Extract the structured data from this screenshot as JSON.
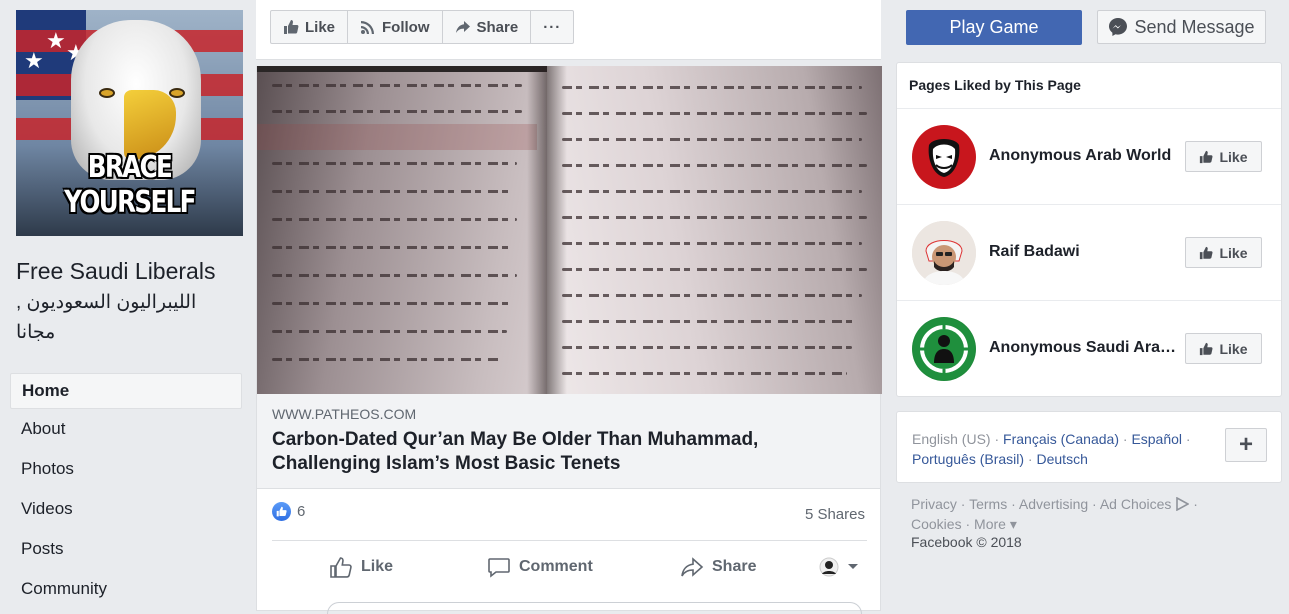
{
  "page": {
    "profile_image_text": "BRACE YOURSELF",
    "name": "Free Saudi Liberals",
    "name_ar": "الليبراليون السعوديون , مجانا"
  },
  "left_nav": {
    "items": [
      {
        "label": "Home",
        "active": true
      },
      {
        "label": "About"
      },
      {
        "label": "Photos"
      },
      {
        "label": "Videos"
      },
      {
        "label": "Posts"
      },
      {
        "label": "Community"
      }
    ]
  },
  "action_bar": {
    "like": "Like",
    "follow": "Follow",
    "share": "Share",
    "more": "···"
  },
  "cta": {
    "play_game": "Play Game",
    "send_message": "Send Message"
  },
  "post": {
    "domain": "WWW.PATHEOS.COM",
    "title": "Carbon-Dated Qur’an May Be Older Than Muhammad, Challenging Islam’s Most Basic Tenets",
    "like_count": "6",
    "shares": "5 Shares",
    "actions": {
      "like": "Like",
      "comment": "Comment",
      "share": "Share"
    }
  },
  "pages_liked": {
    "title": "Pages Liked by This Page",
    "items": [
      {
        "name": "Anonymous Arab World",
        "button": "Like"
      },
      {
        "name": "Raif Badawi",
        "button": "Like"
      },
      {
        "name": "Anonymous Saudi Arabia",
        "button": "Like"
      }
    ]
  },
  "languages": {
    "current": "English (US)",
    "others": [
      "Français (Canada)",
      "Español",
      "Português (Brasil)",
      "Deutsch"
    ],
    "sep": " · ",
    "plus": "+"
  },
  "footer": {
    "links": [
      "Privacy",
      "Terms",
      "Advertising",
      "Ad Choices",
      "Cookies",
      "More ▾"
    ],
    "copyright": "Facebook © 2018"
  },
  "colors": {
    "brand": "#4267b2",
    "link": "#365899",
    "background": "#e9ebee",
    "muted": "#90949c"
  }
}
